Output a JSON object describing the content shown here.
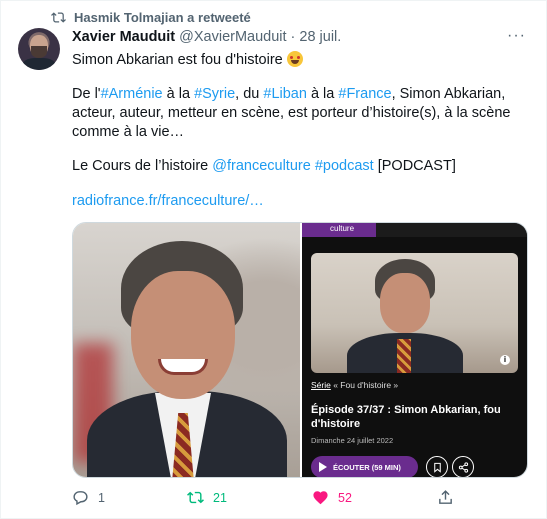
{
  "retweet": {
    "icon": "retweet-icon",
    "text": "Hasmik Tolmajian a retweeté"
  },
  "author": {
    "name": "Xavier Mauduit",
    "handle": "@XavierMauduit",
    "separator": "·",
    "date": "28 juil.",
    "more": "···"
  },
  "body": {
    "line1": "Simon Abkarian est fou d'histoire",
    "p2_a": "De l'",
    "tag_armenie": "#Arménie",
    "p2_b": " à la ",
    "tag_syrie": "#Syrie",
    "p2_c": ", du ",
    "tag_liban": "#Liban",
    "p2_d": " à la ",
    "tag_france": "#France",
    "p2_e": ", Simon Abkarian, acteur, auteur, metteur en scène, est porteur d’histoire(s), à la scène comme à la vie…",
    "p3_a": "Le Cours de l’histoire ",
    "mention": "@franceculture",
    "p3_b": " ",
    "tag_podcast": "#podcast",
    "p3_c": " [PODCAST]",
    "url": "radiofrance.fr/franceculture/…"
  },
  "card": {
    "brand": "culture",
    "serie_label": "Série",
    "serie_sep": " « ",
    "serie_name": "Fou d'histoire",
    "serie_end": " »",
    "episode_title": "Épisode 37/37 : Simon Abkarian, fou d'histoire",
    "episode_date": "Dimanche 24 juillet 2022",
    "listen_label": "ÉCOUTER (59 MIN)",
    "info": "i"
  },
  "actions": {
    "replies": "1",
    "retweets": "21",
    "likes": "52"
  },
  "colors": {
    "link": "#1d9bf0",
    "retweet_green": "#00ba7c",
    "like_pink": "#f91880",
    "card_purple": "#6a2c8e"
  }
}
